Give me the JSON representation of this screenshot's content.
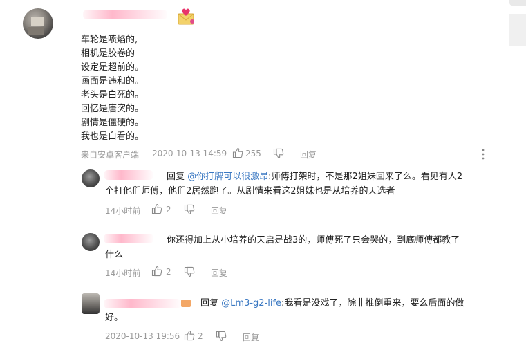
{
  "main_comment": {
    "lines": [
      "车轮是喷焰的,",
      "相机是胶卷的",
      "设定是超前的。",
      "画面是违和的。",
      "老头是白死的。",
      "回忆是唐突的。",
      "剧情是僵硬的。",
      "我也是白看的。"
    ],
    "source": "来自安卓客户端",
    "time": "2020-10-13 14:59",
    "likes": "255",
    "reply_label": "回复"
  },
  "replies": [
    {
      "prefix": "回复",
      "mention": "@你打牌可以很激昂",
      "line1": ":师傅打架时，不是那2姐妹回来了么。看见有人2",
      "line2": "个打他们师傅，他们2居然跑了。从剧情来看这2姐妹也是从培养的天选者",
      "time": "14小时前",
      "likes": "2",
      "reply_label": "回复"
    },
    {
      "line1": "你还得加上从小培养的天启是战3的，师傅死了只会哭的，到底师傅都教了",
      "line2": "什么",
      "time": "14小时前",
      "likes": "2",
      "reply_label": "回复"
    },
    {
      "prefix": "回复",
      "mention": "@Lm3-g2-life",
      "line1": ":我看是没戏了，除非推倒重来，要么后面的做",
      "line2": "好。",
      "time": "2020-10-13 19:56",
      "likes": "2",
      "reply_label": "回复"
    }
  ],
  "icons": {
    "like": "thumbs-up-icon",
    "dislike": "thumbs-down-icon",
    "more": "more-vertical-icon",
    "badge": "love-letter-icon"
  },
  "colors": {
    "mention": "#3a78c2",
    "meta": "#9a9a9a"
  }
}
